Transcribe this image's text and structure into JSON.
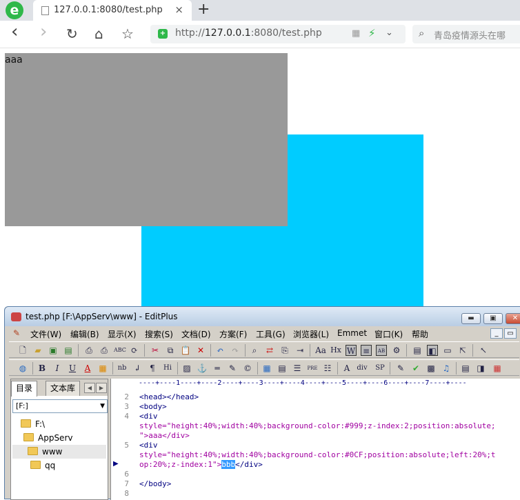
{
  "browser": {
    "logo_letter": "e",
    "tab_title": "127.0.0.1:8080/test.php",
    "tab_close": "×",
    "new_tab": "+",
    "nav": {
      "back": "‹",
      "forward": "›",
      "reload": "↻",
      "home": "⌂",
      "star": "☆"
    },
    "url_prefix": "http://",
    "url_host": "127.0.0.1",
    "url_rest": ":8080/test.php",
    "search_placeholder": "青岛疫情源头在哪"
  },
  "page": {
    "gray_box_text": "aaa",
    "gray_color": "#999",
    "cyan_color": "#0CF"
  },
  "editplus": {
    "title": "test.php [F:\\AppServ\\www] - EditPlus",
    "menus": [
      "文件(W)",
      "编辑(B)",
      "显示(X)",
      "搜索(S)",
      "文档(D)",
      "方案(F)",
      "工具(G)",
      "浏览器(L)",
      "Emmet",
      "窗口(K)",
      "帮助"
    ],
    "sidebar": {
      "tab_dir": "目录",
      "tab_lib": "文本库",
      "drive": "[F:]",
      "tree": [
        "F:\\",
        "AppServ",
        "www",
        "qq"
      ]
    },
    "ruler": "----+----1----+----2----+----3----+----4----+----5----+----6----+----7----+----",
    "lines": [
      {
        "n": "2",
        "text": "<head></head>"
      },
      {
        "n": "3",
        "text": "<body>"
      },
      {
        "n": "4",
        "text": "<div"
      },
      {
        "n": "",
        "text": "style=\"height:40%;width:40%;background-color:#999;z-index:2;position:absolute;"
      },
      {
        "n": "",
        "text": "\">aaa</div>"
      },
      {
        "n": "5",
        "text": "<div"
      },
      {
        "n": "",
        "text": "style=\"height:40%;width:40%;background-color:#0CF;position:absolute;left:20%;t"
      },
      {
        "n": "",
        "text": "op:20%;z-index:1\">"
      },
      {
        "n": "6",
        "text": ""
      },
      {
        "n": "7",
        "text": "</body>"
      },
      {
        "n": "8",
        "text": ""
      }
    ],
    "selected_word": "bbb",
    "after_selected": "</div>"
  }
}
